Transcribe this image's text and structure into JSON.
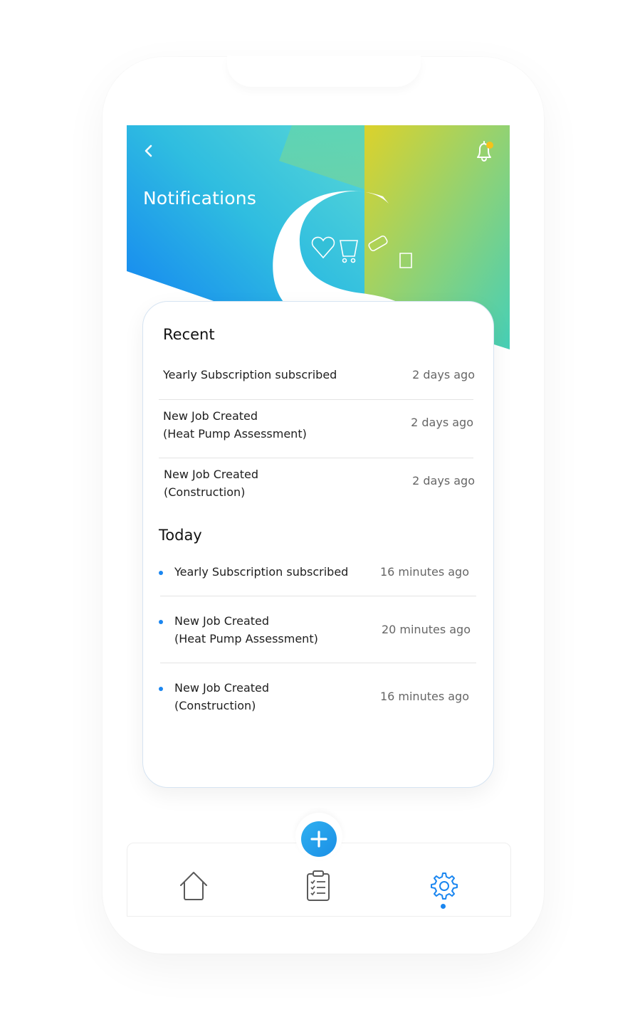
{
  "header": {
    "title": "Notifications",
    "back_icon": "chevron-left-icon",
    "bell_icon": "bell-icon",
    "bell_badge_color": "#f6c21a"
  },
  "colors": {
    "gradient_blue": "#1a7ff2",
    "gradient_teal": "#4fd6d6",
    "gradient_yellow": "#e0d12a",
    "gradient_green": "#6ccf84",
    "accent": "#1a86f0"
  },
  "recent": {
    "title": "Recent",
    "items": [
      {
        "line1": "Yearly Subscription subscribed",
        "line2": "",
        "time": "2 days ago"
      },
      {
        "line1": "New Job Created",
        "line2": "(Heat Pump Assessment)",
        "time": "2 days ago"
      },
      {
        "line1": "New Job Created",
        "line2": "(Construction)",
        "time": "2 days ago"
      }
    ]
  },
  "today": {
    "title": "Today",
    "items": [
      {
        "line1": "Yearly Subscription subscribed",
        "line2": "",
        "time": "16 minutes ago"
      },
      {
        "line1": "New Job Created",
        "line2": "(Heat Pump Assessment)",
        "time": "20 minutes ago"
      },
      {
        "line1": "New Job Created",
        "line2": "(Construction)",
        "time": "16 minutes ago"
      }
    ]
  },
  "tabbar": {
    "add_icon": "plus-icon",
    "tabs": [
      {
        "icon": "home-icon",
        "active": false
      },
      {
        "icon": "clipboard-checklist-icon",
        "active": false
      },
      {
        "icon": "gear-icon",
        "active": true
      }
    ]
  }
}
